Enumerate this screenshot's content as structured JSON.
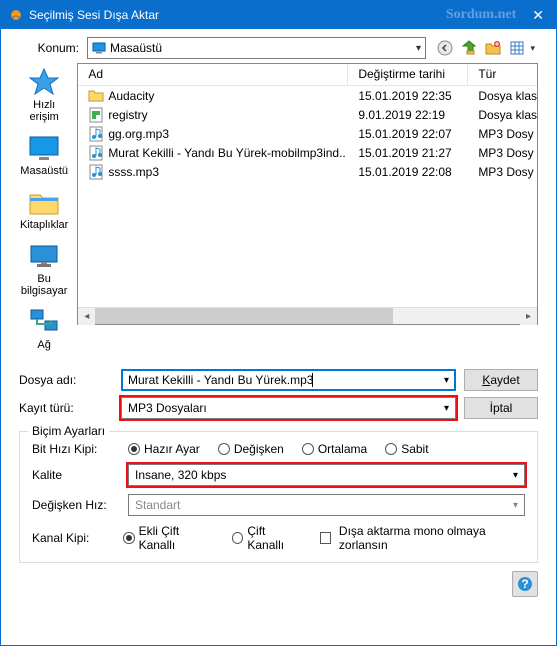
{
  "window": {
    "title": "Seçilmiş Sesi Dışa Aktar",
    "watermark": "Sordum.net"
  },
  "location": {
    "label": "Konum:",
    "value": "Masaüstü"
  },
  "columns": {
    "name": "Ad",
    "date": "Değiştirme tarihi",
    "type": "Tür"
  },
  "files": [
    {
      "icon": "folder",
      "name": "Audacity",
      "date": "15.01.2019 22:35",
      "type": "Dosya klas"
    },
    {
      "icon": "reg",
      "name": "registry",
      "date": "9.01.2019 22:19",
      "type": "Dosya klas"
    },
    {
      "icon": "mp3",
      "name": "gg.org.mp3",
      "date": "15.01.2019 22:07",
      "type": "MP3 Dosy"
    },
    {
      "icon": "mp3",
      "name": "Murat Kekilli - Yandı Bu Yürek-mobilmp3ind..",
      "date": "15.01.2019 21:27",
      "type": "MP3 Dosy"
    },
    {
      "icon": "mp3",
      "name": "ssss.mp3",
      "date": "15.01.2019 22:08",
      "type": "MP3 Dosy"
    }
  ],
  "places": {
    "quick": "Hızlı erişim",
    "desktop": "Masaüstü",
    "libraries": "Kitaplıklar",
    "thispc": "Bu bilgisayar",
    "network": "Ağ"
  },
  "filename": {
    "label": "Dosya adı:",
    "value": "Murat Kekilli - Yandı Bu Yürek.mp3"
  },
  "filetype": {
    "label": "Kayıt türü:",
    "value": "MP3 Dosyaları"
  },
  "buttons": {
    "save": "Kaydet",
    "cancel": "İptal"
  },
  "format": {
    "legend": "Biçim Ayarları",
    "bitrate_mode_label": "Bit Hızı Kipi:",
    "modes": {
      "preset": "Hazır Ayar",
      "variable": "Değişken",
      "average": "Ortalama",
      "constant": "Sabit"
    },
    "quality_label": "Kalite",
    "quality_value": "Insane, 320 kbps",
    "var_speed_label": "Değişken Hız:",
    "var_speed_value": "Standart",
    "channel_label": "Kanal Kipi:",
    "ch_joint": "Ekli Çift Kanallı",
    "ch_stereo": "Çift Kanallı",
    "force_mono": "Dışa aktarma mono olmaya zorlansın"
  },
  "help": "?"
}
